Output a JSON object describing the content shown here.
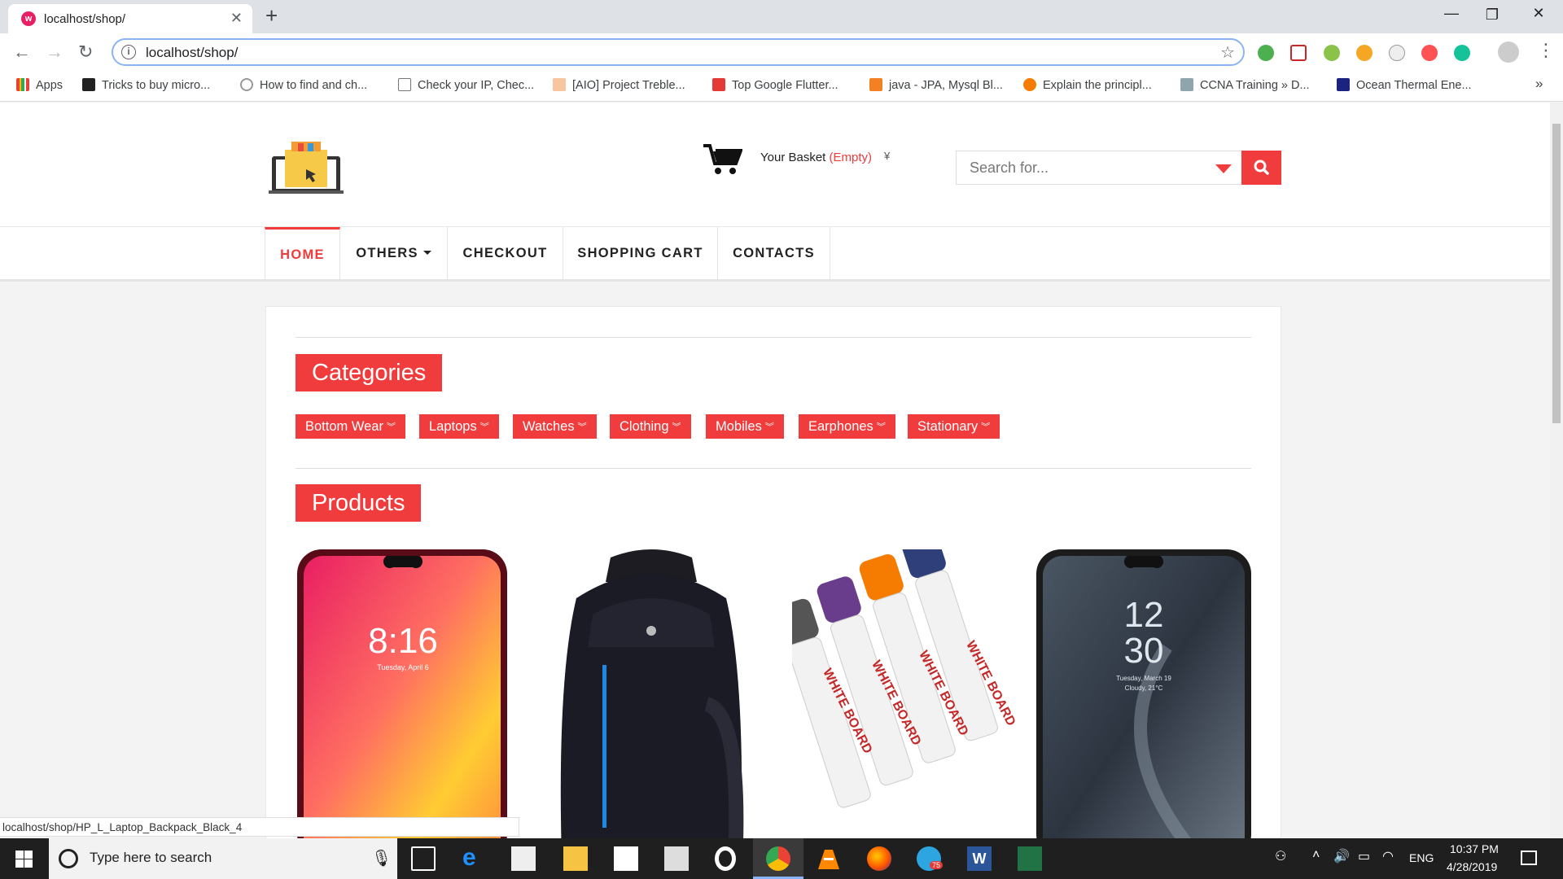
{
  "browser": {
    "tab_title": "localhost/shop/",
    "url": "localhost/shop/",
    "bookmarks": [
      "Apps",
      "Tricks to buy micro...",
      "How to find and ch...",
      "Check your IP, Chec...",
      "[AIO] Project Treble...",
      "Top Google Flutter...",
      "java - JPA, Mysql Bl...",
      "Explain the principl...",
      "CCNA Training » D...",
      "Ocean Thermal Ene..."
    ],
    "overflow": "»",
    "status_url": "localhost/shop/HP_L_Laptop_Backpack_Black_4"
  },
  "header": {
    "basket_label": "Your Basket",
    "basket_status": "(Empty)",
    "search_placeholder": "Search for..."
  },
  "nav": [
    "HOME",
    "OTHERS",
    "CHECKOUT",
    "SHOPPING CART",
    "CONTACTS"
  ],
  "categories": {
    "title": "Categories",
    "items": [
      "Bottom Wear",
      "Laptops",
      "Watches",
      "Clothing",
      "Mobiles",
      "Earphones",
      "Stationary"
    ]
  },
  "products": {
    "title": "Products",
    "phone1": {
      "time": "8:16",
      "date": "Tuesday, April 6"
    },
    "marker_text": "WHITE BOARD",
    "phone2": {
      "hour": "12",
      "minute": "30",
      "date": "Tuesday, March 19",
      "weather": "Cloudy, 21°C"
    }
  },
  "taskbar": {
    "search_placeholder": "Type here to search",
    "language": "ENG",
    "time": "10:37 PM",
    "date": "4/28/2019",
    "telegram_badge": "75"
  },
  "colors": {
    "accent": "#f03c3c",
    "chrome_tab_bg": "#dee1e6",
    "taskbar": "#1f1f1f"
  }
}
